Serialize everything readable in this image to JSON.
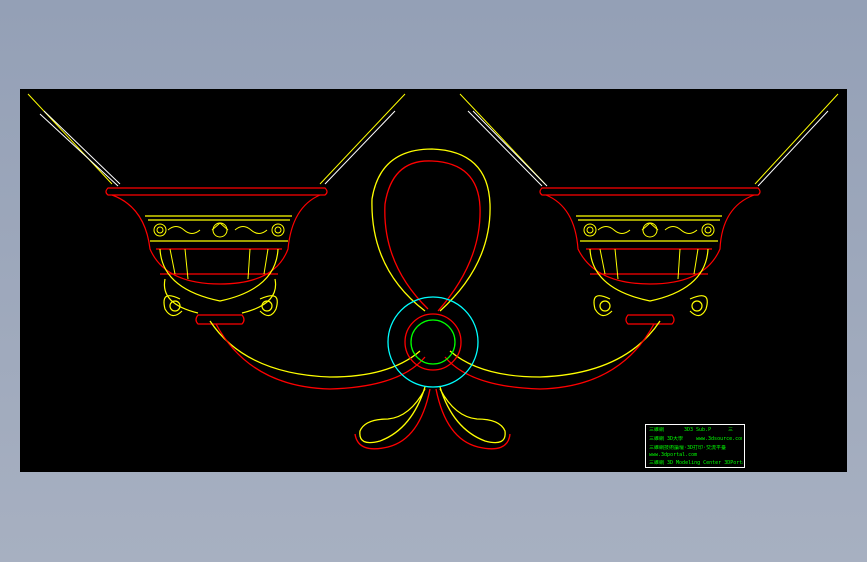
{
  "drawing": {
    "background": "#000000",
    "colors": {
      "red": "#ff0000",
      "yellow": "#ffff00",
      "cyan": "#00ffff",
      "green": "#00ff00",
      "white": "#ffffff"
    }
  },
  "title_block": {
    "row1_left": "三維網",
    "row1_mid": "3D3 Sub.P",
    "row1_right": "三",
    "row2_left": "三維網 3D大學",
    "row2_right": "www.3dsource.com",
    "row3": "三維網技術論壇·3D打印·交流平臺",
    "row4": "www.3dportal.com",
    "row5": "三維網 3D Modeling Center 3DPortal.com"
  }
}
